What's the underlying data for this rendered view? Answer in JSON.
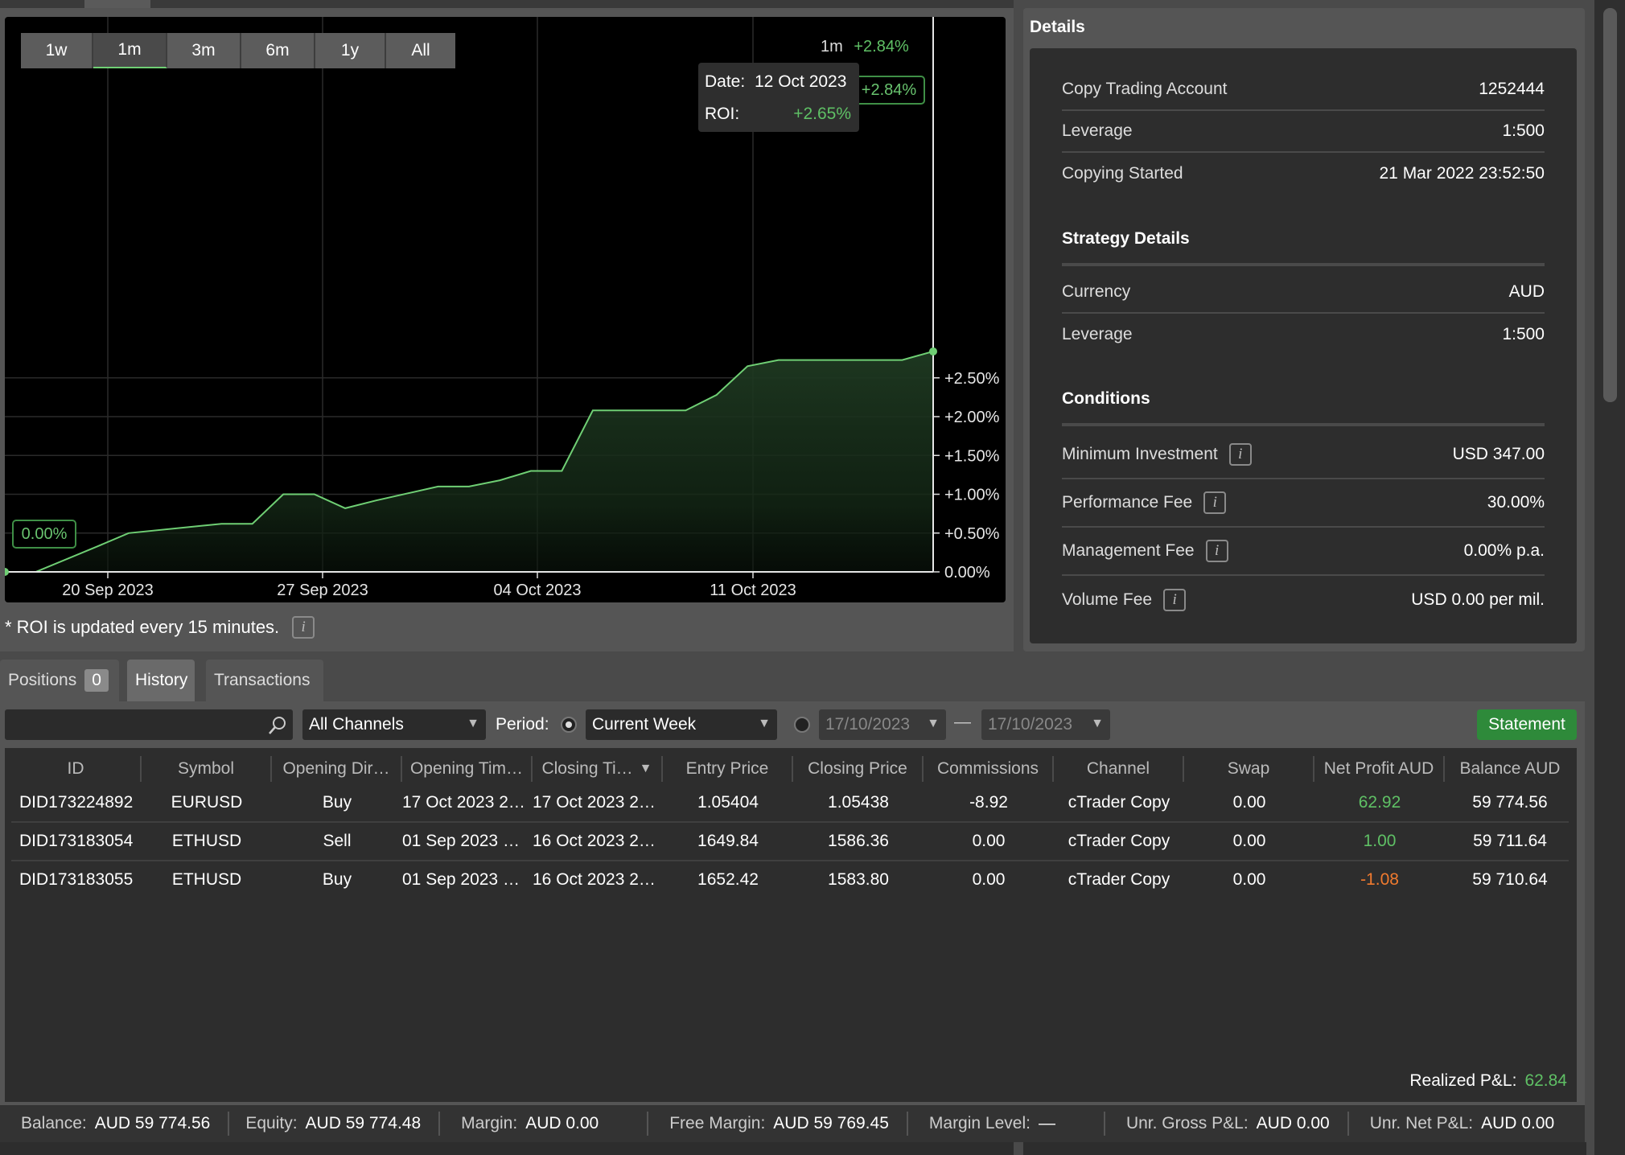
{
  "chart": {
    "ranges": [
      "1w",
      "1m",
      "3m",
      "6m",
      "1y",
      "All"
    ],
    "active_range": "1m",
    "header_period": "1m",
    "header_roi": "+2.84%",
    "end_badge": "+2.84%",
    "start_badge": "0.00%",
    "tooltip": {
      "date_label": "Date:",
      "date_value": "12 Oct 2023",
      "roi_label": "ROI:",
      "roi_value": "+2.65%"
    },
    "roi_note": "* ROI is updated every 15 minutes.",
    "accent_color": "#6fcf74"
  },
  "chart_data": {
    "type": "area",
    "x_tick_labels": [
      "20 Sep 2023",
      "27 Sep 2023",
      "04 Oct 2023",
      "11 Oct 2023"
    ],
    "y_tick_labels": [
      "0.00%",
      "+0.50%",
      "+1.00%",
      "+1.50%",
      "+2.00%",
      "+2.50%"
    ],
    "ylim": [
      0,
      3.0
    ],
    "xlim": [
      0,
      30
    ],
    "x": [
      0,
      1,
      3,
      4,
      7,
      8,
      9,
      10,
      11,
      12,
      14,
      15,
      16,
      17,
      18,
      19,
      20,
      22,
      23,
      24,
      25,
      26,
      27,
      28,
      29,
      30
    ],
    "values": [
      0.0,
      0.0,
      0.33,
      0.5,
      0.62,
      0.62,
      1.0,
      1.0,
      0.82,
      0.92,
      1.1,
      1.1,
      1.18,
      1.3,
      1.3,
      2.08,
      2.08,
      2.08,
      2.28,
      2.65,
      2.73,
      2.73,
      2.73,
      2.73,
      2.73,
      2.84
    ]
  },
  "details": {
    "title": "Details",
    "rows": [
      {
        "label": "Copy Trading Account",
        "value": "1252444"
      },
      {
        "label": "Leverage",
        "value": "1:500"
      },
      {
        "label": "Copying Started",
        "value": "21 Mar 2022 23:52:50"
      }
    ],
    "strategy_title": "Strategy Details",
    "strategy_rows": [
      {
        "label": "Currency",
        "value": "AUD"
      },
      {
        "label": "Leverage",
        "value": "1:500"
      }
    ],
    "conditions_title": "Conditions",
    "condition_rows": [
      {
        "label": "Minimum Investment",
        "value": "USD 347.00"
      },
      {
        "label": "Performance Fee",
        "value": "30.00%"
      },
      {
        "label": "Management Fee",
        "value": "0.00% p.a."
      },
      {
        "label": "Volume Fee",
        "value": "USD 0.00 per mil."
      }
    ],
    "info_glyph": "i"
  },
  "tabs": {
    "positions": "Positions",
    "positions_count": "0",
    "history": "History",
    "transactions": "Transactions"
  },
  "filters": {
    "channels": "All Channels",
    "period_label": "Period:",
    "period": "Current Week",
    "date_from": "17/10/2023",
    "date_sep": "—",
    "date_to": "17/10/2023",
    "statement": "Statement"
  },
  "table": {
    "headers": [
      "ID",
      "Symbol",
      "Opening Dir…",
      "Opening Tim…",
      "Closing Ti…",
      "Entry Price",
      "Closing Price",
      "Commissions",
      "Channel",
      "Swap",
      "Net Profit AUD",
      "Balance AUD"
    ],
    "sort_indicator": "▼",
    "rows": [
      [
        "DID173224892",
        "EURUSD",
        "Buy",
        "17 Oct 2023 2…",
        "17 Oct 2023 2…",
        "1.05404",
        "1.05438",
        "-8.92",
        "cTrader Copy",
        "0.00",
        "62.92",
        "59 774.56"
      ],
      [
        "DID173183054",
        "ETHUSD",
        "Sell",
        "01 Sep 2023 …",
        "16 Oct 2023 2…",
        "1649.84",
        "1586.36",
        "0.00",
        "cTrader Copy",
        "0.00",
        "1.00",
        "59 711.64"
      ],
      [
        "DID173183055",
        "ETHUSD",
        "Buy",
        "01 Sep 2023 …",
        "16 Oct 2023 2…",
        "1652.42",
        "1583.80",
        "0.00",
        "cTrader Copy",
        "0.00",
        "-1.08",
        "59 710.64"
      ]
    ],
    "profit_sign": [
      "pos",
      "pos",
      "neg"
    ],
    "realized_label": "Realized P&L:",
    "realized_value": "62.84"
  },
  "status": {
    "balance_label": "Balance:",
    "balance": "AUD 59 774.56",
    "equity_label": "Equity:",
    "equity": "AUD 59 774.48",
    "margin_label": "Margin:",
    "margin": "AUD 0.00",
    "free_margin_label": "Free Margin:",
    "free_margin": "AUD 59 769.45",
    "margin_level_label": "Margin Level:",
    "margin_level": "—",
    "unr_gross_label": "Unr. Gross P&L:",
    "unr_gross": "AUD 0.00",
    "unr_net_label": "Unr. Net P&L:",
    "unr_net": "AUD 0.00"
  }
}
